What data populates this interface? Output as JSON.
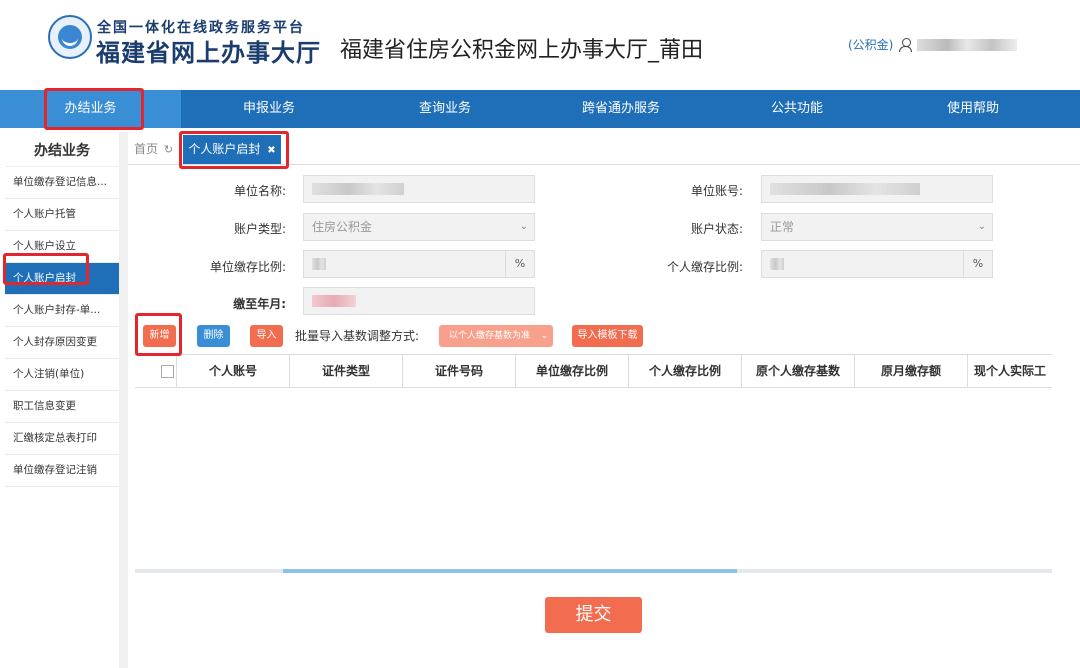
{
  "header": {
    "logo_top": "全国一体化在线政务服务平台",
    "logo_main": "福建省网上办事大厅",
    "site_title": "福建省住房公积金网上办事大厅_莆田",
    "user_label": "(公积金)"
  },
  "nav": {
    "items": [
      "办结业务",
      "申报业务",
      "查询业务",
      "跨省通办服务",
      "公共功能",
      "使用帮助"
    ]
  },
  "sidebar": {
    "title": "办结业务",
    "items": [
      "单位缴存登记信息...",
      "个人账户托管",
      "个人账户设立",
      "个人账户启封",
      "个人账户封存-单...",
      "个人封存原因变更",
      "个人注销(单位)",
      "职工信息变更",
      "汇缴核定总表打印",
      "单位缴存登记注销"
    ]
  },
  "tabs": {
    "home": "首页",
    "home_icon": "refresh-icon",
    "active": "个人账户启封",
    "close_icon": "✖"
  },
  "form": {
    "unit_name_label": "单位名称:",
    "unit_account_label": "单位账号:",
    "account_type_label": "账户类型:",
    "account_type_value": "住房公积金",
    "account_status_label": "账户状态:",
    "account_status_value": "正常",
    "unit_ratio_label": "单位缴存比例:",
    "personal_ratio_label": "个人缴存比例:",
    "pct": "%",
    "paid_until_label": "缴至年月:"
  },
  "toolbar": {
    "add": "新增",
    "delete": "删除",
    "import": "导入",
    "batch_label": "批量导入基数调整方式:",
    "batch_value": "以个人缴存基数为准",
    "template": "导入模板下载"
  },
  "table": {
    "headers": [
      "个人账号",
      "证件类型",
      "证件号码",
      "单位缴存比例",
      "个人缴存比例",
      "原个人缴存基数",
      "原月缴存额",
      "现个人实际工"
    ]
  },
  "submit_label": "提交",
  "colors": {
    "primary": "#1e6fb7",
    "accent": "#f26d4f",
    "highlight_border": "#e3262b"
  }
}
